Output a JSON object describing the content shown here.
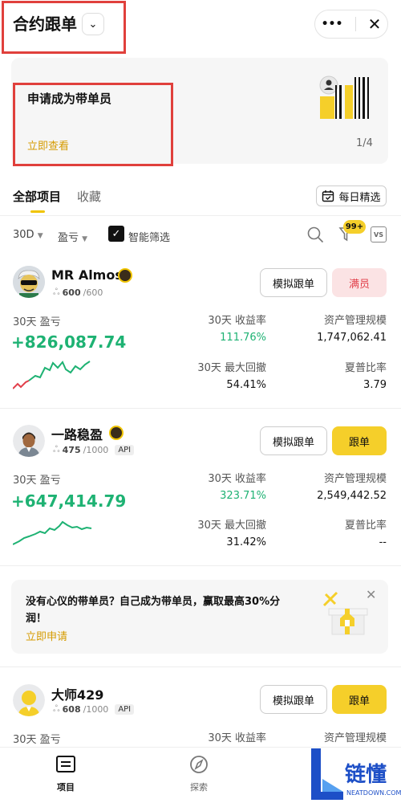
{
  "header": {
    "title": "合约跟单",
    "more_glyph": "•••",
    "close_glyph": "✕"
  },
  "banner": {
    "title": "申请成为带单员",
    "link": "立即查看",
    "pager": "1/4"
  },
  "tabs": [
    {
      "label": "全部项目",
      "active": true
    },
    {
      "label": "收藏",
      "active": false
    }
  ],
  "daily_pick": {
    "label": "每日精选",
    "icon": "calendar-icon"
  },
  "filters": {
    "period": "30D",
    "metric": "盈亏",
    "smart_filter": "智能筛选",
    "notification_count": "99+",
    "vs_label": "VS"
  },
  "traders": [
    {
      "name": "MR Almost",
      "followers": "600",
      "capacity": "/600",
      "api": "",
      "pnl_label": "30天 盈亏",
      "pnl": "+826,087.74",
      "roi_label": "30天 收益率",
      "roi": "111.76%",
      "aum_label": "资产管理规模",
      "aum": "1,747,062.41",
      "mdd_label": "30天 最大回撤",
      "mdd": "54.41%",
      "sharpe_label": "夏普比率",
      "sharpe": "3.79",
      "sim_button": "模拟跟单",
      "action_button": "满员",
      "action_style": "full"
    },
    {
      "name": "一路稳盈",
      "followers": "475",
      "capacity": "/1000",
      "api": "API",
      "pnl_label": "30天 盈亏",
      "pnl": "+647,414.79",
      "roi_label": "30天 收益率",
      "roi": "323.71%",
      "aum_label": "资产管理规模",
      "aum": "2,549,442.52",
      "mdd_label": "30天 最大回撤",
      "mdd": "31.42%",
      "sharpe_label": "夏普比率",
      "sharpe": "--",
      "sim_button": "模拟跟单",
      "action_button": "跟单",
      "action_style": "follow"
    },
    {
      "name": "大师429",
      "followers": "608",
      "capacity": "/1000",
      "api": "API",
      "pnl_label": "30天 盈亏",
      "roi_label": "30天 收益率",
      "aum_label": "资产管理规模",
      "sim_button": "模拟跟单",
      "action_button": "跟单",
      "action_style": "follow"
    }
  ],
  "promo": {
    "text": "没有心仪的带单员？自己成为带单员，赢取最高30%分润！",
    "link": "立即申请"
  },
  "bottom_nav": [
    {
      "label": "项目",
      "icon": "list-icon"
    },
    {
      "label": "探索",
      "icon": "compass-icon"
    }
  ],
  "watermark": {
    "text": "链懂",
    "sub": "NEATDOWN.COM"
  },
  "colors": {
    "accent": "#f5cf2a",
    "profit": "#1eb273",
    "loss": "#e2404b",
    "link": "#d59b00"
  }
}
